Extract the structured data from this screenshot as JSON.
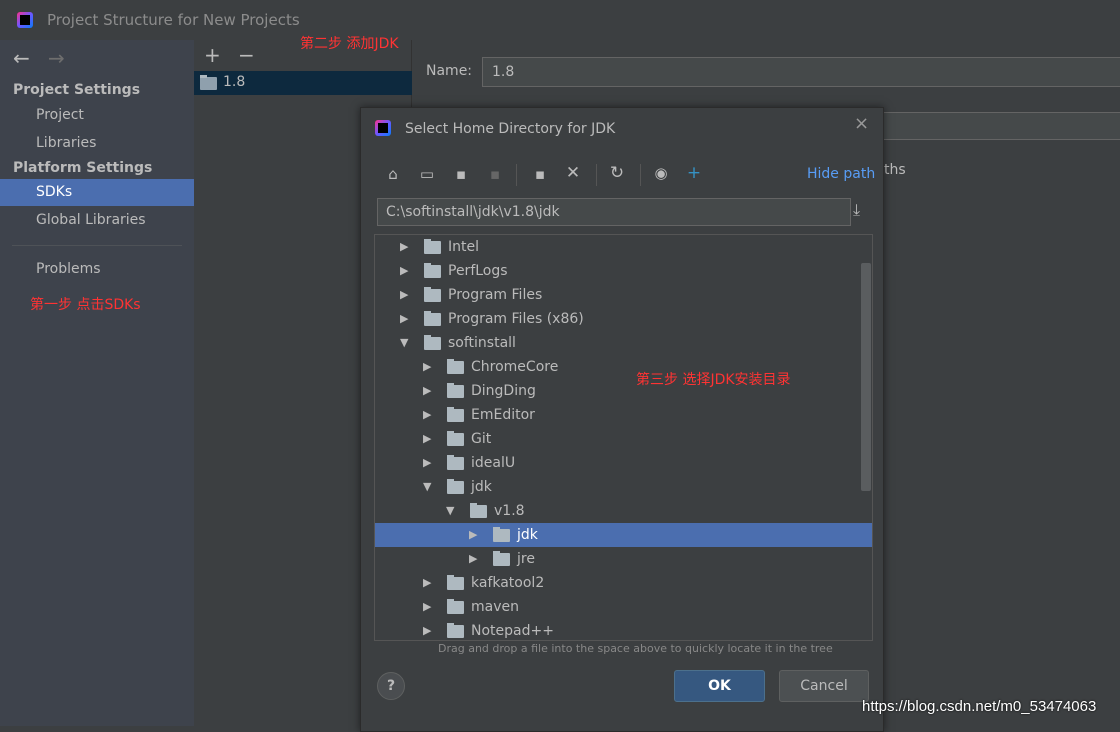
{
  "window": {
    "title": "Project Structure for New Projects"
  },
  "sidebar": {
    "project_settings": "Project Settings",
    "platform_settings": "Platform Settings",
    "items": [
      {
        "label": "Project"
      },
      {
        "label": "Libraries"
      },
      {
        "label": "SDKs",
        "selected": true
      },
      {
        "label": "Global Libraries"
      },
      {
        "label": "Problems"
      }
    ]
  },
  "sdk_list": {
    "add": "+",
    "remove": "−",
    "items": [
      {
        "label": "1.8"
      }
    ]
  },
  "right": {
    "name_label": "Name:",
    "name_value": "1.8",
    "paths_fragment": "ths"
  },
  "annotations": {
    "step1": "第一步 点击SDKs",
    "step2": "第二步 添加JDK",
    "step3": "第三步 选择JDK安装目录"
  },
  "dialog": {
    "title": "Select Home Directory for JDK",
    "hide_path": "Hide path",
    "path": "C:\\softinstall\\jdk\\v1.8\\jdk",
    "tree": [
      {
        "label": "Intel",
        "level": 0,
        "expanded": false
      },
      {
        "label": "PerfLogs",
        "level": 0,
        "expanded": false
      },
      {
        "label": "Program Files",
        "level": 0,
        "expanded": false
      },
      {
        "label": "Program Files (x86)",
        "level": 0,
        "expanded": false
      },
      {
        "label": "softinstall",
        "level": 0,
        "expanded": true
      },
      {
        "label": "ChromeCore",
        "level": 1,
        "expanded": false
      },
      {
        "label": "DingDing",
        "level": 1,
        "expanded": false
      },
      {
        "label": "EmEditor",
        "level": 1,
        "expanded": false
      },
      {
        "label": "Git",
        "level": 1,
        "expanded": false
      },
      {
        "label": "idealU",
        "level": 1,
        "expanded": false
      },
      {
        "label": "jdk",
        "level": 1,
        "expanded": true
      },
      {
        "label": "v1.8",
        "level": 2,
        "expanded": true
      },
      {
        "label": "jdk",
        "level": 3,
        "expanded": false,
        "selected": true
      },
      {
        "label": "jre",
        "level": 3,
        "expanded": false
      },
      {
        "label": "kafkatool2",
        "level": 1,
        "expanded": false
      },
      {
        "label": "maven",
        "level": 1,
        "expanded": false
      },
      {
        "label": "Notepad++",
        "level": 1,
        "expanded": false
      }
    ],
    "hint": "Drag and drop a file into the space above to quickly locate it in the tree",
    "help": "?",
    "ok": "OK",
    "cancel": "Cancel"
  },
  "watermark": "https://blog.csdn.net/m0_53474063",
  "colors": {
    "accent": "#4b6eaf",
    "link": "#589df6",
    "annotation": "#ff3333"
  }
}
